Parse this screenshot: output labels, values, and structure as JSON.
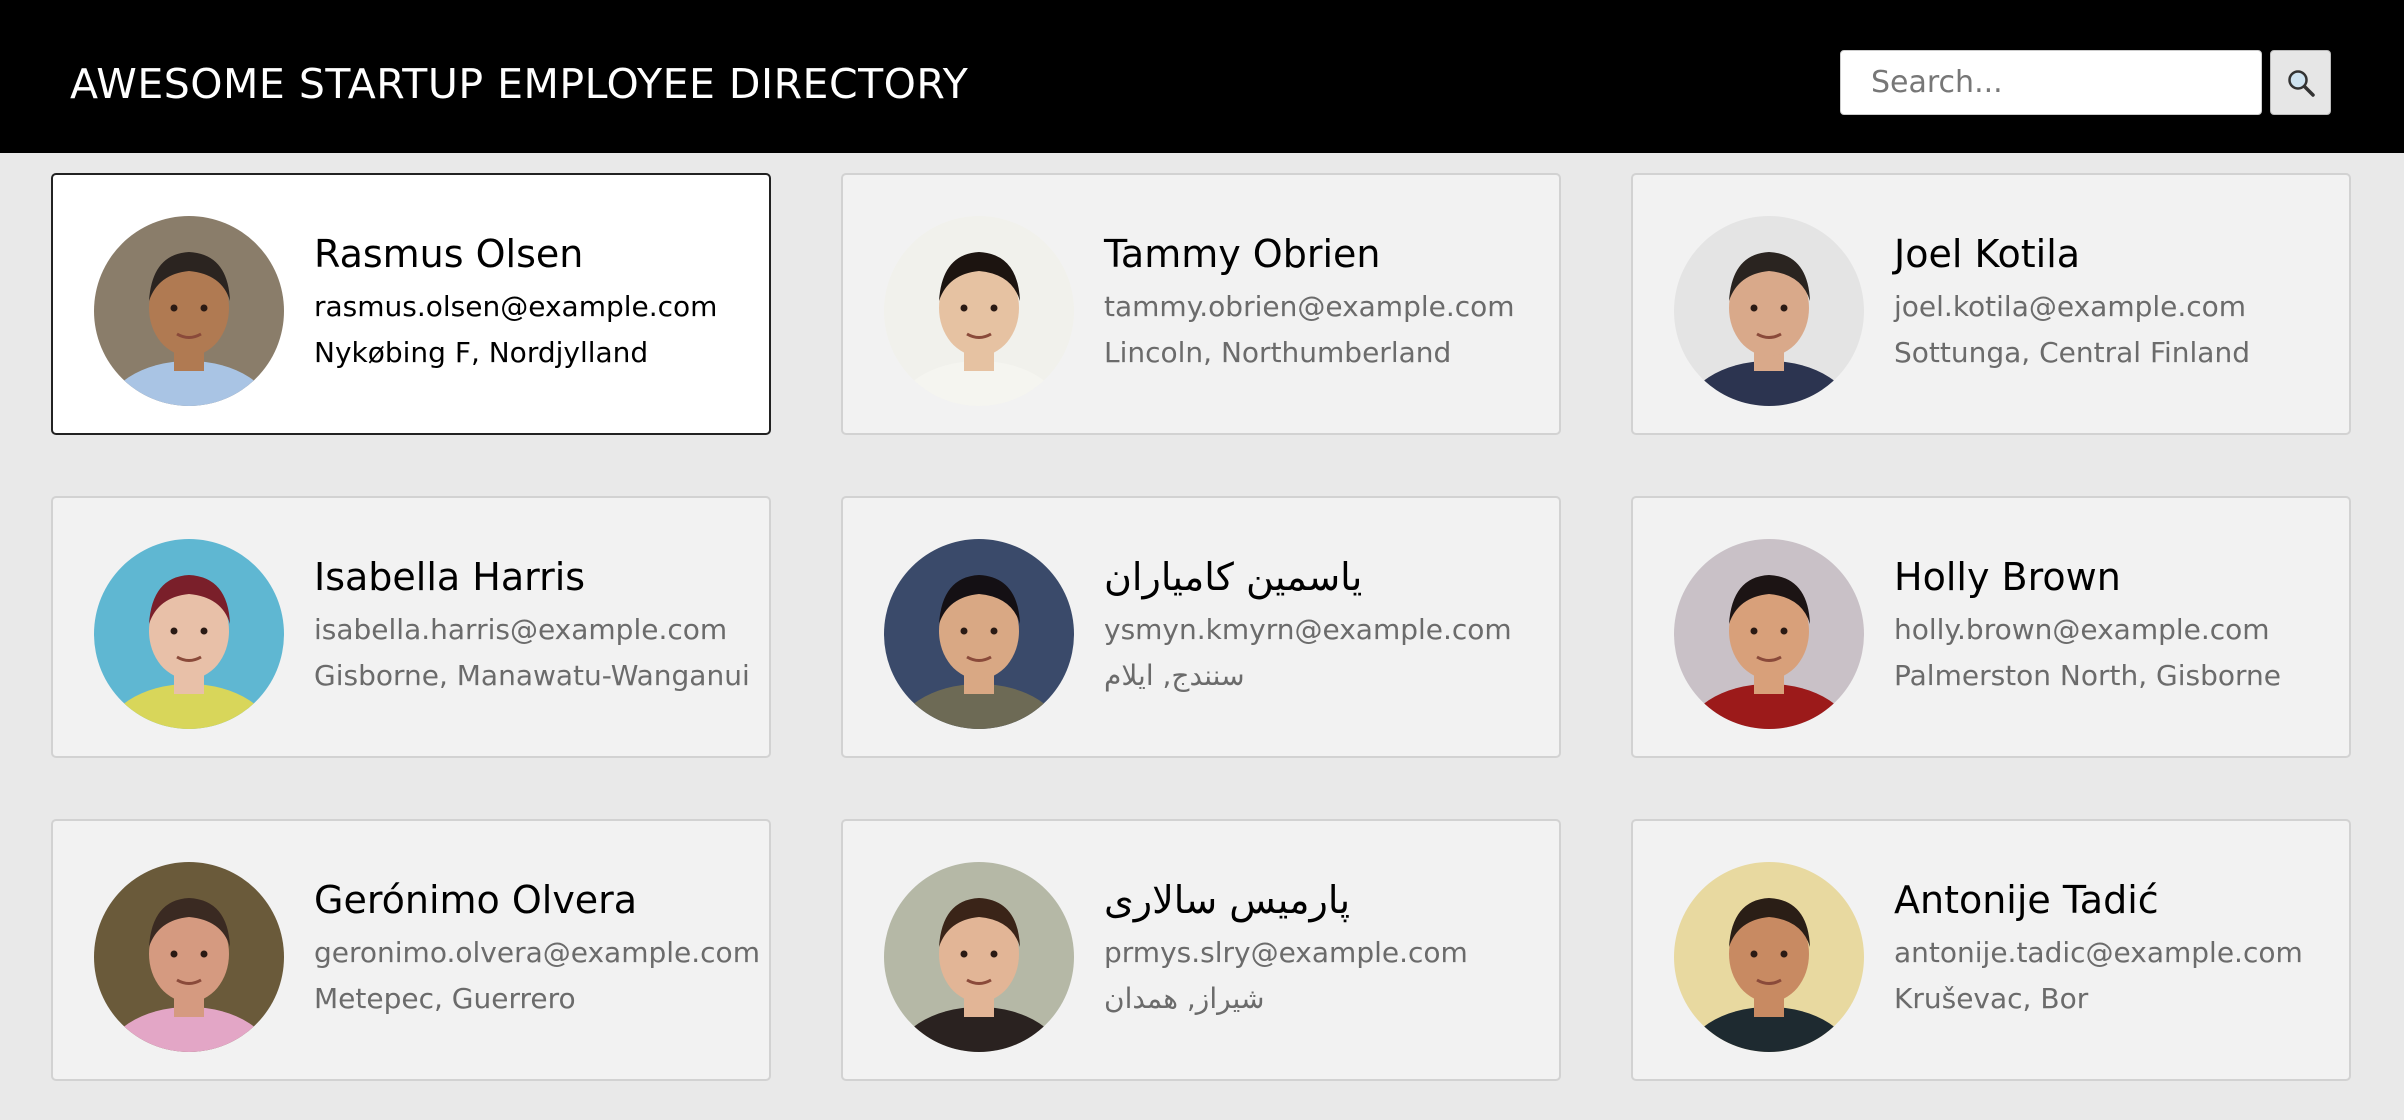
{
  "header": {
    "title": "AWESOME STARTUP EMPLOYEE DIRECTORY",
    "search": {
      "placeholder": "Search...",
      "value": "",
      "button_icon": "search-icon"
    }
  },
  "employees": [
    {
      "name": "Rasmus Olsen",
      "email": "rasmus.olsen@example.com",
      "location": "Nykøbing F, Nordjylland",
      "selected": true,
      "avatar": {
        "bg": "#8a7d6a",
        "skin": "#b07a52",
        "hair": "#2b2420",
        "shirt": "#a9c4e4"
      }
    },
    {
      "name": "Tammy Obrien",
      "email": "tammy.obrien@example.com",
      "location": "Lincoln, Northumberland",
      "selected": false,
      "avatar": {
        "bg": "#f1f1ec",
        "skin": "#e6c2a2",
        "hair": "#1c1410",
        "shirt": "#f5f5f0"
      }
    },
    {
      "name": "Joel Kotila",
      "email": "joel.kotila@example.com",
      "location": "Sottunga, Central Finland",
      "selected": false,
      "avatar": {
        "bg": "#e4e4e4",
        "skin": "#d9a98a",
        "hair": "#2a2420",
        "shirt": "#2c3450"
      }
    },
    {
      "name": "Isabella Harris",
      "email": "isabella.harris@example.com",
      "location": "Gisborne, Manawatu-Wanganui",
      "selected": false,
      "avatar": {
        "bg": "#5fb7d2",
        "skin": "#e8c0a8",
        "hair": "#7a1f2a",
        "shirt": "#d8d65a"
      }
    },
    {
      "name": "یاسمین کامیاران",
      "email": "ysmyn.kmyrn@example.com",
      "location": "سنندج, ایلام",
      "selected": false,
      "avatar": {
        "bg": "#3a4a6a",
        "skin": "#d9a884",
        "hair": "#141014",
        "shirt": "#6d6a55"
      }
    },
    {
      "name": "Holly Brown",
      "email": "holly.brown@example.com",
      "location": "Palmerston North, Gisborne",
      "selected": false,
      "avatar": {
        "bg": "#c9c1c7",
        "skin": "#d8a07a",
        "hair": "#1c1414",
        "shirt": "#9c1a1a"
      }
    },
    {
      "name": "Gerónimo Olvera",
      "email": "geronimo.olvera@example.com",
      "location": "Metepec, Guerrero",
      "selected": false,
      "avatar": {
        "bg": "#6a5a3a",
        "skin": "#d59a80",
        "hair": "#3a2a22",
        "shirt": "#e3a6c6"
      }
    },
    {
      "name": "پارمیس سالاری",
      "email": "prmys.slry@example.com",
      "location": "شیراز, همدان",
      "selected": false,
      "avatar": {
        "bg": "#b5b8a6",
        "skin": "#e2b596",
        "hair": "#3a2418",
        "shirt": "#2a2220"
      }
    },
    {
      "name": "Antonije Tadić",
      "email": "antonije.tadic@example.com",
      "location": "Kruševac, Bor",
      "selected": false,
      "avatar": {
        "bg": "#e8d9a0",
        "skin": "#c88a62",
        "hair": "#2a1e16",
        "shirt": "#1e2a30"
      }
    }
  ]
}
